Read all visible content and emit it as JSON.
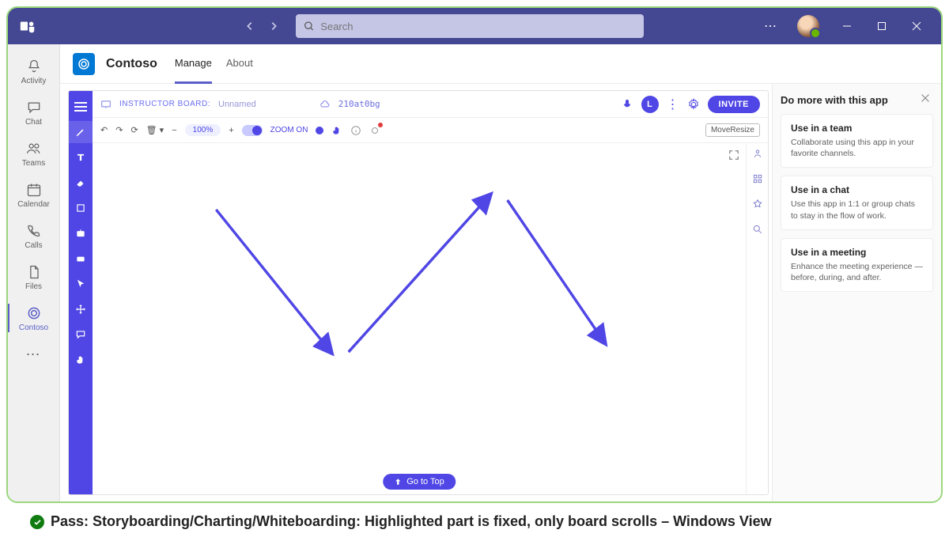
{
  "titlebar": {
    "search_placeholder": "Search"
  },
  "leftrail": {
    "items": [
      {
        "label": "Activity"
      },
      {
        "label": "Chat"
      },
      {
        "label": "Teams"
      },
      {
        "label": "Calendar"
      },
      {
        "label": "Calls"
      },
      {
        "label": "Files"
      },
      {
        "label": "Contoso"
      }
    ]
  },
  "appheader": {
    "name": "Contoso",
    "tabs": [
      {
        "label": "Manage",
        "active": true
      },
      {
        "label": "About",
        "active": false
      }
    ]
  },
  "whiteboard": {
    "board_label": "INSTRUCTOR BOARD:",
    "board_name": "Unnamed",
    "board_code": "210at0bg",
    "user_initial": "L",
    "invite_label": "INVITE",
    "zoom_pct": "100%",
    "zoom_toggle_label": "ZOOM ON",
    "move_resize": "MoveResize",
    "go_to_top": "Go to Top"
  },
  "rightpanel": {
    "title": "Do more with this app",
    "cards": [
      {
        "title": "Use in a team",
        "desc": "Collaborate using this app in your favorite channels."
      },
      {
        "title": "Use in a chat",
        "desc": "Use this app in 1:1 or group chats to stay in the flow of work."
      },
      {
        "title": "Use in a meeting",
        "desc": "Enhance the meeting experience — before, during, and after."
      }
    ]
  },
  "caption": {
    "prefix": "Pass: ",
    "text": "Storyboarding/Charting/Whiteboarding: Highlighted part is fixed, only board scrolls – Windows View"
  }
}
